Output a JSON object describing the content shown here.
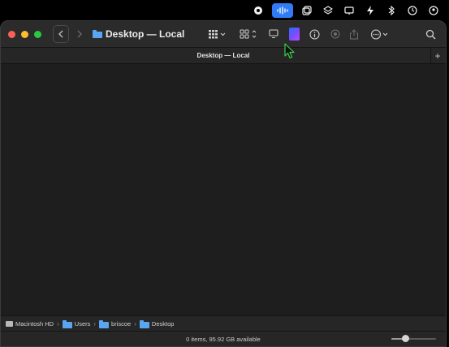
{
  "menubar": {
    "icons": [
      "record-icon",
      "voice-memo-icon",
      "window-icon",
      "layers-icon",
      "display-icon",
      "bolt-icon",
      "bluetooth-icon",
      "timemachine-icon",
      "user-icon"
    ]
  },
  "window": {
    "title": "Desktop — Local",
    "tab_title": "Desktop — Local",
    "tab_add": "+"
  },
  "toolbar": {
    "view_chevron": "⌄",
    "group_chevron": "⌃⌄",
    "more_chevron": "⌄"
  },
  "pathbar": {
    "items": [
      {
        "label": "Macintosh HD",
        "icon": "disk-icon"
      },
      {
        "label": "Users",
        "icon": "folder-icon"
      },
      {
        "label": "briscoe",
        "icon": "folder-icon"
      },
      {
        "label": "Desktop",
        "icon": "folder-icon"
      }
    ]
  },
  "status": {
    "text": "0 items, 95.92 GB available",
    "icon_size_fraction": 0.3
  },
  "colors": {
    "folder": "#5aa5f1",
    "accent": "#2f7cf6",
    "cursor": "#3fd04a"
  }
}
